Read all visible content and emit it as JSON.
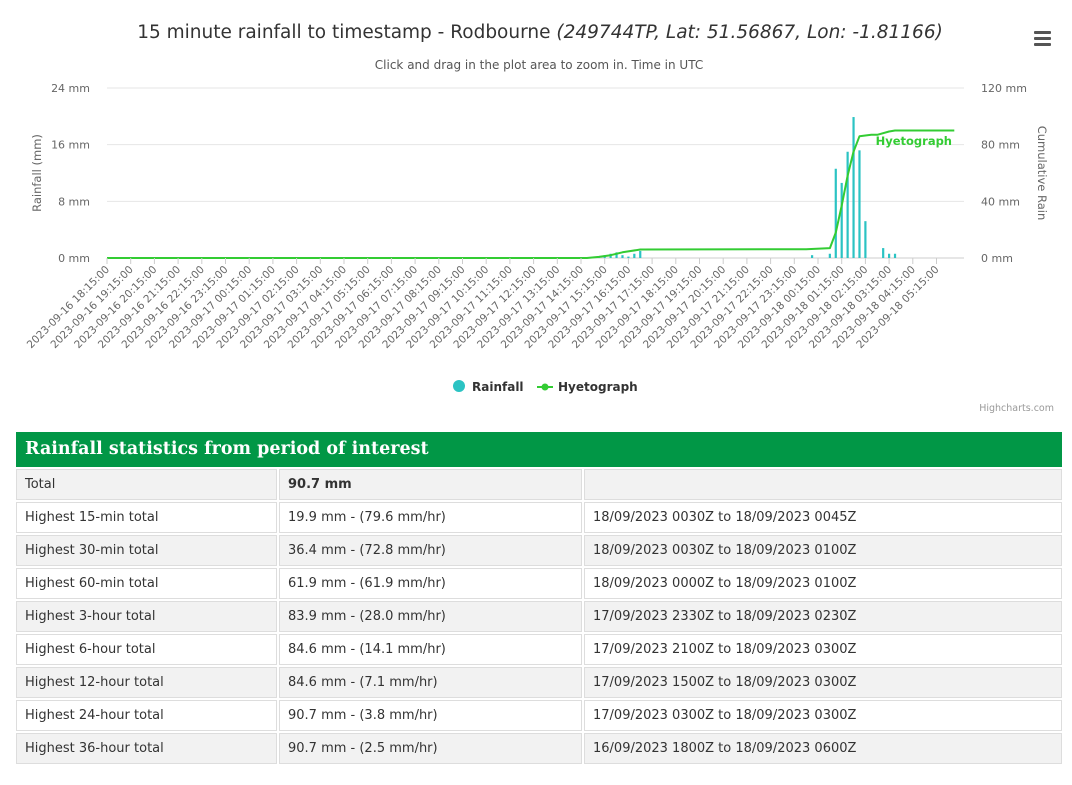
{
  "chart": {
    "title_main": "15 minute rainfall to timestamp - Rodbourne",
    "title_sub": "(249744TP, Lat: 51.56867, Lon: -1.81166)",
    "subtitle": "Click and drag in the plot area to zoom in. Time in UTC",
    "credits": "Highcharts.com",
    "menu_icon": "hamburger-menu-icon"
  },
  "chart_data": {
    "type": "bar",
    "title": "15 minute rainfall to timestamp - Rodbourne (249744TP, Lat: 51.56867, Lon: -1.81166)",
    "subtitle": "Click and drag in the plot area to zoom in. Time in UTC",
    "ylabel": "Rainfall (mm)",
    "y2label": "Cumulative Rain",
    "ylim": [
      0,
      24
    ],
    "y2lim": [
      0,
      120
    ],
    "yticks": [
      "0 mm",
      "8 mm",
      "16 mm",
      "24 mm"
    ],
    "y2ticks": [
      "0 mm",
      "40 mm",
      "80 mm",
      "120 mm"
    ],
    "grid": true,
    "legend_position": "bottom-center",
    "x_labels": [
      "2023-09-16 18:15:00",
      "2023-09-16 19:15:00",
      "2023-09-16 20:15:00",
      "2023-09-16 21:15:00",
      "2023-09-16 22:15:00",
      "2023-09-16 23:15:00",
      "2023-09-17 00:15:00",
      "2023-09-17 01:15:00",
      "2023-09-17 02:15:00",
      "2023-09-17 03:15:00",
      "2023-09-17 04:15:00",
      "2023-09-17 05:15:00",
      "2023-09-17 06:15:00",
      "2023-09-17 07:15:00",
      "2023-09-17 08:15:00",
      "2023-09-17 09:15:00",
      "2023-09-17 10:15:00",
      "2023-09-17 11:15:00",
      "2023-09-17 12:15:00",
      "2023-09-17 13:15:00",
      "2023-09-17 14:15:00",
      "2023-09-17 15:15:00",
      "2023-09-17 16:15:00",
      "2023-09-17 17:15:00",
      "2023-09-17 18:15:00",
      "2023-09-17 19:15:00",
      "2023-09-17 20:15:00",
      "2023-09-17 21:15:00",
      "2023-09-17 22:15:00",
      "2023-09-17 23:15:00",
      "2023-09-18 00:15:00",
      "2023-09-18 01:15:00",
      "2023-09-18 02:15:00",
      "2023-09-18 03:15:00",
      "2023-09-18 04:15:00",
      "2023-09-18 05:15:00"
    ],
    "series": [
      {
        "name": "Rainfall",
        "type": "column",
        "color": "#2bc3c3",
        "unit": "mm",
        "points": [
          {
            "x": "2023-09-17 15:00",
            "y": 0.2
          },
          {
            "x": "2023-09-17 15:15",
            "y": 0.4
          },
          {
            "x": "2023-09-17 15:30",
            "y": 0.6
          },
          {
            "x": "2023-09-17 15:45",
            "y": 0.8
          },
          {
            "x": "2023-09-17 16:00",
            "y": 0.4
          },
          {
            "x": "2023-09-17 16:15",
            "y": 0.2
          },
          {
            "x": "2023-09-17 16:30",
            "y": 0.6
          },
          {
            "x": "2023-09-17 16:45",
            "y": 1.0
          },
          {
            "x": "2023-09-18 00:00",
            "y": 0.4
          },
          {
            "x": "2023-09-18 00:45",
            "y": 0.6
          },
          {
            "x": "2023-09-18 01:00",
            "y": 12.6
          },
          {
            "x": "2023-09-18 01:15",
            "y": 10.6
          },
          {
            "x": "2023-09-18 01:30",
            "y": 15.0
          },
          {
            "x": "2023-09-18 01:45",
            "y": 19.9
          },
          {
            "x": "2023-09-18 02:00",
            "y": 15.2
          },
          {
            "x": "2023-09-18 02:15",
            "y": 5.2
          },
          {
            "x": "2023-09-18 03:00",
            "y": 1.4
          },
          {
            "x": "2023-09-18 03:15",
            "y": 0.6
          },
          {
            "x": "2023-09-18 03:30",
            "y": 0.6
          }
        ]
      },
      {
        "name": "Hyetograph",
        "type": "line",
        "axis": "right",
        "color": "#33cc33",
        "unit": "mm",
        "points": [
          {
            "x": "2023-09-16 18:15",
            "y": 0
          },
          {
            "x": "2023-09-17 14:30",
            "y": 0
          },
          {
            "x": "2023-09-17 15:00",
            "y": 0.8
          },
          {
            "x": "2023-09-17 15:30",
            "y": 2.0
          },
          {
            "x": "2023-09-17 16:00",
            "y": 4.0
          },
          {
            "x": "2023-09-17 16:45",
            "y": 6.0
          },
          {
            "x": "2023-09-17 23:45",
            "y": 6.2
          },
          {
            "x": "2023-09-18 00:45",
            "y": 7.0
          },
          {
            "x": "2023-09-18 01:00",
            "y": 18.0
          },
          {
            "x": "2023-09-18 01:15",
            "y": 37.0
          },
          {
            "x": "2023-09-18 01:30",
            "y": 58.0
          },
          {
            "x": "2023-09-18 01:45",
            "y": 75.0
          },
          {
            "x": "2023-09-18 02:00",
            "y": 86.0
          },
          {
            "x": "2023-09-18 02:30",
            "y": 87.0
          },
          {
            "x": "2023-09-18 02:45",
            "y": 87.0
          },
          {
            "x": "2023-09-18 03:15",
            "y": 89.3
          },
          {
            "x": "2023-09-18 03:30",
            "y": 90.0
          },
          {
            "x": "2023-09-18 06:00",
            "y": 90.0
          }
        ],
        "label": "Hyetograph"
      }
    ]
  },
  "stats": {
    "header": "Rainfall statistics from period of interest",
    "rows": [
      {
        "label": "Total",
        "value": "90.7 mm",
        "period": ""
      },
      {
        "label": "Highest 15-min total",
        "value": "19.9 mm - (79.6 mm/hr)",
        "period": "18/09/2023 0030Z to 18/09/2023 0045Z"
      },
      {
        "label": "Highest 30-min total",
        "value": "36.4 mm - (72.8 mm/hr)",
        "period": "18/09/2023 0030Z to 18/09/2023 0100Z"
      },
      {
        "label": "Highest 60-min total",
        "value": "61.9 mm - (61.9 mm/hr)",
        "period": "18/09/2023 0000Z to 18/09/2023 0100Z"
      },
      {
        "label": "Highest 3-hour total",
        "value": "83.9 mm - (28.0 mm/hr)",
        "period": "17/09/2023 2330Z to 18/09/2023 0230Z"
      },
      {
        "label": "Highest 6-hour total",
        "value": "84.6 mm - (14.1 mm/hr)",
        "period": "17/09/2023 2100Z to 18/09/2023 0300Z"
      },
      {
        "label": "Highest 12-hour total",
        "value": "84.6 mm - (7.1 mm/hr)",
        "period": "17/09/2023 1500Z to 18/09/2023 0300Z"
      },
      {
        "label": "Highest 24-hour total",
        "value": "90.7 mm - (3.8 mm/hr)",
        "period": "17/09/2023 0300Z to 18/09/2023 0300Z"
      },
      {
        "label": "Highest 36-hour total",
        "value": "90.7 mm - (2.5 mm/hr)",
        "period": "16/09/2023 1800Z to 18/09/2023 0600Z"
      }
    ]
  }
}
